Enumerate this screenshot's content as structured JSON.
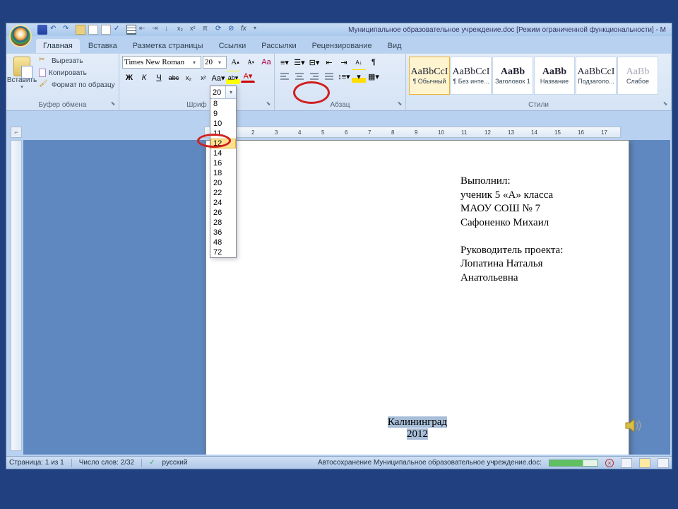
{
  "title": "Муниципальное образовательное учреждение.doc [Режим ограниченной функциональности] - M",
  "tabs": {
    "home": "Главная",
    "insert": "Вставка",
    "layout": "Разметка страницы",
    "refs": "Ссылки",
    "mail": "Рассылки",
    "review": "Рецензирование",
    "view": "Вид"
  },
  "clipboard": {
    "paste": "Вставить",
    "cut": "Вырезать",
    "copy": "Копировать",
    "format": "Формат по образцу",
    "group": "Буфер обмена"
  },
  "font": {
    "name": "Times New Roman",
    "size": "20",
    "group": "Шриф",
    "sizes": [
      "8",
      "9",
      "10",
      "11",
      "12",
      "14",
      "16",
      "18",
      "20",
      "22",
      "24",
      "26",
      "28",
      "36",
      "48",
      "72"
    ],
    "highlight_size": "12"
  },
  "para": {
    "group": "Абзац"
  },
  "styles": {
    "group": "Стили",
    "items": [
      {
        "sample": "AaBbCcI",
        "label": "¶ Обычный",
        "bold": false,
        "selected": true
      },
      {
        "sample": "AaBbCcI",
        "label": "¶ Без инте...",
        "bold": false
      },
      {
        "sample": "AaBb",
        "label": "Заголовок 1",
        "bold": true
      },
      {
        "sample": "AaBb",
        "label": "Название",
        "bold": true
      },
      {
        "sample": "AaBbCcI",
        "label": "Подзаголо...",
        "bold": false
      },
      {
        "sample": "AaBb",
        "label": "Слабое",
        "bold": false,
        "faded": true
      }
    ]
  },
  "document": {
    "right_block": [
      "Выполнил:",
      "ученик 5 «А» класса",
      "МАОУ СОШ № 7",
      "Сафоненко Михаил",
      "",
      "Руководитель проекта:",
      "Лопатина Наталья",
      "Анатольевна"
    ],
    "center_block": [
      "Калининград",
      "2012"
    ]
  },
  "status": {
    "page": "Страница: 1 из 1",
    "words": "Число слов: 2/32",
    "lang": "русский",
    "autosave": "Автосохранение Муниципальное образовательное учреждение.doc:"
  },
  "ruler_max": 17
}
